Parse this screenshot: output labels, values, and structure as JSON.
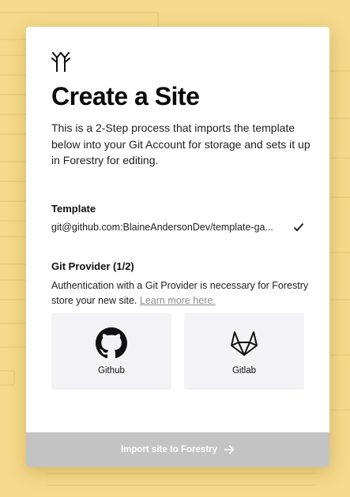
{
  "header": {
    "logo_icon": "forestry-logo-icon",
    "title": "Create a Site",
    "intro": "This is a 2-Step process that imports the template below into your Git Account for storage and sets it up in Forestry for editing."
  },
  "template": {
    "label": "Template",
    "value": "git@github.com:BlaineAndersonDev/template-ga...",
    "status_icon": "checkmark-icon"
  },
  "git_provider": {
    "label": "Git Provider (1/2)",
    "description": "Authentication with a Git Provider is necessary for Forestry store your new site.",
    "learn_more": "Learn more here.",
    "providers": [
      {
        "name": "Github",
        "icon": "github-icon"
      },
      {
        "name": "Gitlab",
        "icon": "gitlab-icon"
      }
    ]
  },
  "footer": {
    "import_label": "Import site to Forestry",
    "import_icon": "arrow-right-icon"
  },
  "colors": {
    "background": "#f6d98a",
    "card": "#ffffff",
    "provider_tile": "#f3f3f5",
    "import_button_disabled": "#c3c3c3",
    "link": "#8d8d8d"
  }
}
